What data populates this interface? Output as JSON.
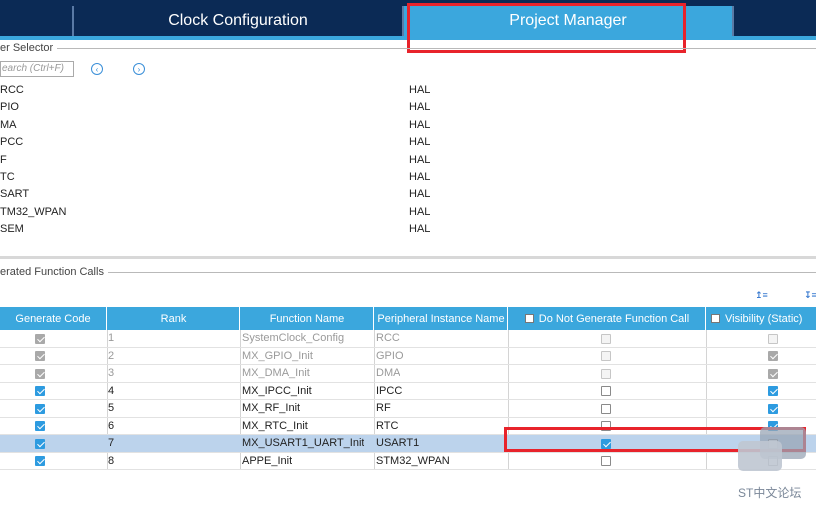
{
  "tabs": [
    {
      "label": "",
      "active": false
    },
    {
      "label": "Clock Configuration",
      "active": false
    },
    {
      "label": "Project Manager",
      "active": true
    },
    {
      "label": "",
      "active": false
    }
  ],
  "driver_selector": {
    "title": "er Selector",
    "search_placeholder": "earch (Ctrl+F)",
    "prev_icon": "circle-chevron-left-icon",
    "next_icon": "circle-chevron-right-icon",
    "rows": [
      {
        "name": "RCC",
        "value": "HAL"
      },
      {
        "name": "PIO",
        "value": "HAL"
      },
      {
        "name": "MA",
        "value": "HAL"
      },
      {
        "name": "PCC",
        "value": "HAL"
      },
      {
        "name": "F",
        "value": "HAL"
      },
      {
        "name": "TC",
        "value": "HAL"
      },
      {
        "name": "SART",
        "value": "HAL"
      },
      {
        "name": "TM32_WPAN",
        "value": "HAL"
      },
      {
        "name": "SEM",
        "value": "HAL"
      }
    ]
  },
  "function_calls": {
    "title": "erated Function Calls",
    "columns": [
      "Generate Code",
      "Rank",
      "Function Name",
      "Peripheral Instance Name",
      "Do Not Generate Function Call",
      "Visibility (Static)"
    ],
    "rows": [
      {
        "generate": "dis-on",
        "rank": "1",
        "function": "SystemClock_Config",
        "peripheral": "RCC",
        "no_call": "dis-off",
        "visibility": "dis-off",
        "gray": true,
        "selected": false
      },
      {
        "generate": "dis-on",
        "rank": "2",
        "function": "MX_GPIO_Init",
        "peripheral": "GPIO",
        "no_call": "dis-off",
        "visibility": "dis-on",
        "gray": true,
        "selected": false
      },
      {
        "generate": "dis-on",
        "rank": "3",
        "function": "MX_DMA_Init",
        "peripheral": "DMA",
        "no_call": "dis-off",
        "visibility": "dis-on",
        "gray": true,
        "selected": false
      },
      {
        "generate": "on",
        "rank": "4",
        "function": "MX_IPCC_Init",
        "peripheral": "IPCC",
        "no_call": "off",
        "visibility": "on",
        "gray": false,
        "selected": false
      },
      {
        "generate": "on",
        "rank": "5",
        "function": "MX_RF_Init",
        "peripheral": "RF",
        "no_call": "off",
        "visibility": "on",
        "gray": false,
        "selected": false
      },
      {
        "generate": "on",
        "rank": "6",
        "function": "MX_RTC_Init",
        "peripheral": "RTC",
        "no_call": "off",
        "visibility": "on",
        "gray": false,
        "selected": false
      },
      {
        "generate": "on",
        "rank": "7",
        "function": "MX_USART1_UART_Init",
        "peripheral": "USART1",
        "no_call": "on",
        "visibility": "off",
        "gray": false,
        "selected": true
      },
      {
        "generate": "on",
        "rank": "8",
        "function": "APPE_Init",
        "peripheral": "STM32_WPAN",
        "no_call": "off",
        "visibility": "off",
        "gray": false,
        "selected": false
      }
    ]
  },
  "toolbar_icons": [
    "sort-up-icon",
    "sort-down-icon"
  ],
  "watermark": {
    "text": "ST中文论坛",
    "icon": "chat-bubbles-icon"
  },
  "colors": {
    "tab_bg": "#0b2a55",
    "accent": "#3ba7dd",
    "highlight": "#e8232b",
    "selected_row": "#bcd3ec"
  }
}
